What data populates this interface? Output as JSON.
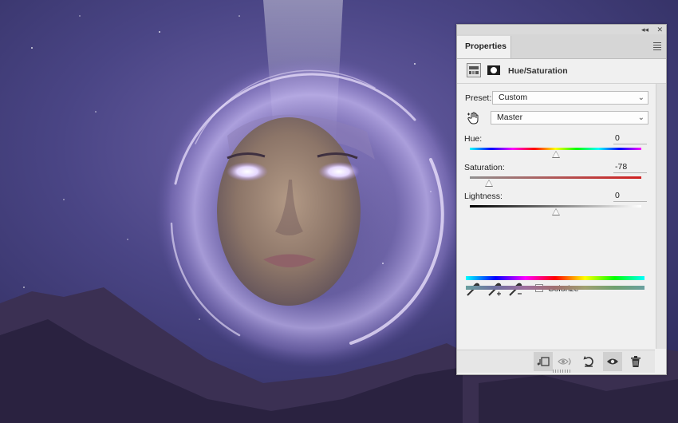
{
  "panel": {
    "tab_label": "Properties",
    "adjustment_title": "Hue/Saturation",
    "collapse_glyph": "◂◂",
    "close_glyph": "✕"
  },
  "preset": {
    "label": "Preset:",
    "value": "Custom"
  },
  "channel": {
    "value": "Master"
  },
  "hue": {
    "label": "Hue:",
    "value": "0",
    "position": 0.5
  },
  "saturation": {
    "label": "Saturation:",
    "value": "-78",
    "position": 0.11
  },
  "lightness": {
    "label": "Lightness:",
    "value": "0",
    "position": 0.5
  },
  "colorize": {
    "label": "Colorize",
    "checked": false
  },
  "icons": {
    "adjustment": "adjustment-layer-icon",
    "mask": "mask-icon",
    "targeted_adjust": "hand-target-icon",
    "eyedropper": "eyedropper-icon",
    "eyedropper_add": "eyedropper-add-icon",
    "eyedropper_subtract": "eyedropper-subtract-icon",
    "clip": "clip-to-layer-icon",
    "view_previous": "view-previous-icon",
    "reset": "reset-icon",
    "visibility": "eye-icon",
    "delete": "trash-icon"
  },
  "colors": {
    "panel_bg": "#f0f0f0",
    "saturation_track_end": "#d02020"
  }
}
